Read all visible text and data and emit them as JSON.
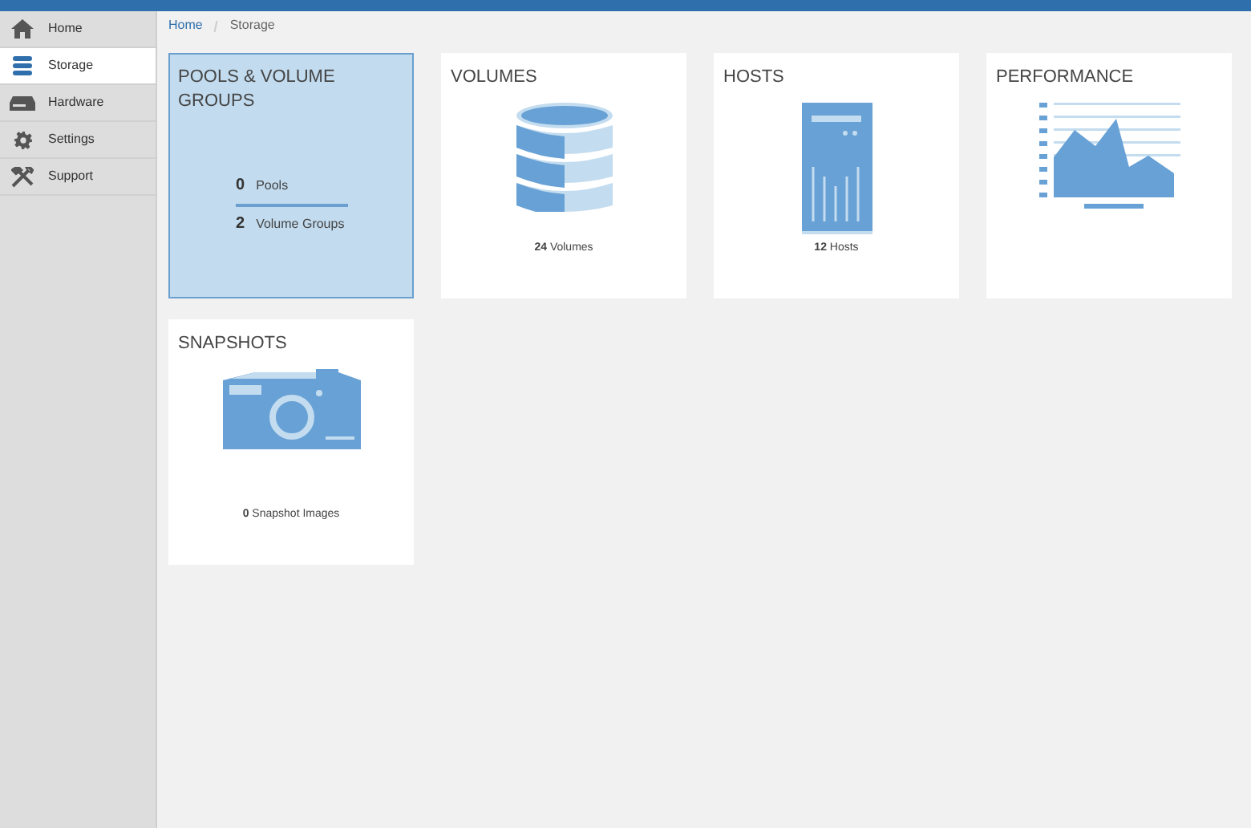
{
  "sidebar": {
    "items": [
      {
        "label": "Home",
        "kind": "home",
        "selected": false
      },
      {
        "label": "Storage",
        "kind": "storage",
        "selected": true
      },
      {
        "label": "Hardware",
        "kind": "hardware",
        "selected": false
      },
      {
        "label": "Settings",
        "kind": "settings",
        "selected": false
      },
      {
        "label": "Support",
        "kind": "support",
        "selected": false
      }
    ]
  },
  "breadcrumb": [
    {
      "label": "Home",
      "link": true
    },
    {
      "label": "Storage",
      "link": false
    }
  ],
  "tiles": [
    {
      "title": "POOLS & VOLUME GROUPS",
      "kind": "groups",
      "selected": true,
      "stats": [
        {
          "count": "0",
          "label": "Pools"
        },
        {
          "count": "2",
          "label": "Volume Groups"
        }
      ]
    },
    {
      "title": "VOLUMES",
      "kind": "volumes",
      "selected": false,
      "stats": [
        {
          "count": "24",
          "label": "Volumes"
        }
      ]
    },
    {
      "title": "HOSTS",
      "kind": "hosts",
      "selected": false,
      "stats": [
        {
          "count": "12",
          "label": "Hosts"
        }
      ]
    },
    {
      "title": "PERFORMANCE",
      "kind": "performance",
      "selected": false
    },
    {
      "title": "SNAPSHOTS",
      "kind": "snapshots",
      "selected": false,
      "stats": [
        {
          "count": "0",
          "label": "Snapshot Images"
        }
      ]
    }
  ]
}
